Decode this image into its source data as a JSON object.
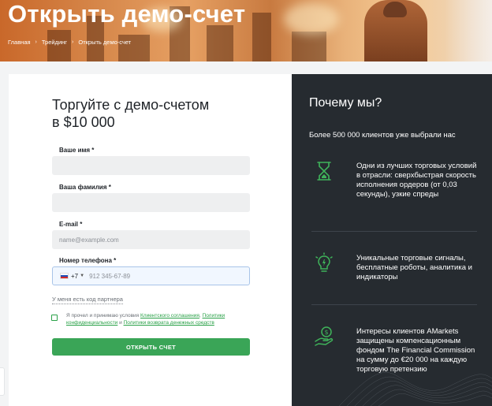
{
  "hero": {
    "title": "Открыть демо-счет",
    "breadcrumbs": [
      "Главная",
      "Трейдинг",
      "Открыть демо-счет"
    ]
  },
  "form": {
    "title_line1": "Торгуйте с демо-счетом",
    "title_line2": "в $10 000",
    "name_label": "Ваше имя *",
    "name_value": "",
    "surname_label": "Ваша фамилия *",
    "surname_value": "",
    "email_label": "E-mail *",
    "email_placeholder": "name@example.com",
    "phone_label": "Номер телефона *",
    "phone_country_code": "+7",
    "phone_placeholder": "912 345-67-89",
    "partner_link": "У меня есть код партнера",
    "agree_prefix": "Я прочел и принимаю условия ",
    "agree_link1": "Клиентского соглашения",
    "agree_sep1": ", ",
    "agree_link2": "Политики конфиденциальности",
    "agree_sep2": " и ",
    "agree_link3": "Политики возврата денежных средств",
    "submit_label": "ОТКРЫТЬ СЧЕТ"
  },
  "why": {
    "title": "Почему мы?",
    "subtitle": "Более 500 000 клиентов уже выбрали нас",
    "benefits": [
      {
        "icon": "hourglass-icon",
        "text": "Одни из лучших торговых условий в отрасли: сверхбыстрая скорость исполнения ордеров (от 0,03 секунды), узкие спреды"
      },
      {
        "icon": "lightbulb-icon",
        "text": "Уникальные торговые сигналы, бесплатные роботы, аналитика и индикаторы"
      },
      {
        "icon": "money-hand-icon",
        "text": "Интересы клиентов AMarkets защищены компенсационным фондом The Financial Commission на сумму до €20 000 на каждую торговую претензию"
      }
    ]
  },
  "colors": {
    "accent_green": "#3aa557",
    "panel_dark": "#262b30",
    "link_green": "#2aa148"
  }
}
